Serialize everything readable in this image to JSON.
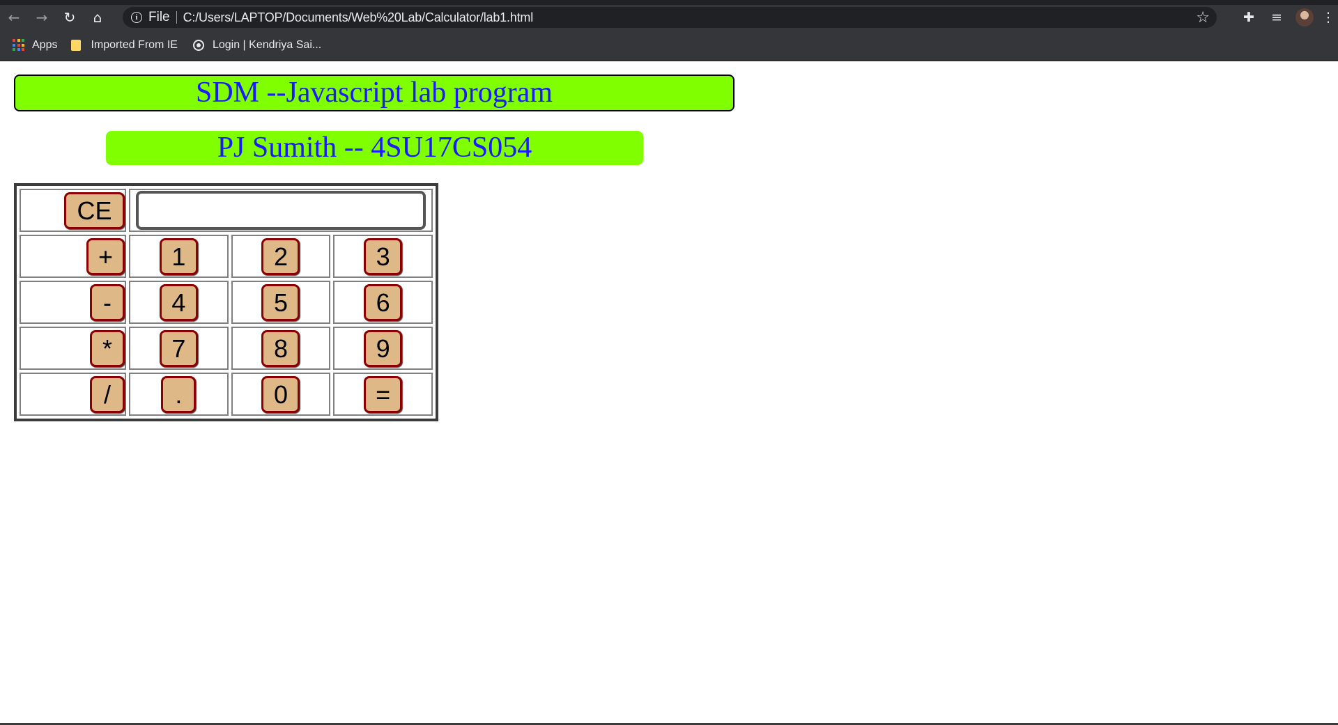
{
  "browser": {
    "nav": {
      "back_icon": "←",
      "forward_icon": "→",
      "reload_icon": "↻",
      "home_icon": "⌂"
    },
    "address": {
      "info_icon": "i",
      "scheme_label": "File",
      "url": "C:/Users/LAPTOP/Documents/Web%20Lab/Calculator/lab1.html",
      "star_icon": "☆"
    },
    "toolbar_icons": {
      "extensions_icon": "✚",
      "reading_list_icon": "≡",
      "menu_icon": "⋮"
    },
    "bookmarks": [
      {
        "label": "Apps"
      },
      {
        "label": "Imported From IE"
      },
      {
        "label": "Login | Kendriya Sai..."
      }
    ],
    "apps_colors": [
      "#ea4335",
      "#fbbc04",
      "#34a853",
      "#4285f4",
      "#ea4335",
      "#fbbc04",
      "#34a853",
      "#4285f4",
      "#ea4335"
    ]
  },
  "page": {
    "title": "SDM --Javascript lab program",
    "subtitle": "PJ Sumith -- 4SU17CS054",
    "accent_color": "#80ff00",
    "text_color": "#1a1aff"
  },
  "calculator": {
    "display_value": "",
    "clear_label": "CE",
    "rows": [
      {
        "op": "+",
        "keys": [
          "1",
          "2",
          "3"
        ]
      },
      {
        "op": "-",
        "keys": [
          "4",
          "5",
          "6"
        ]
      },
      {
        "op": "*",
        "keys": [
          "7",
          "8",
          "9"
        ]
      },
      {
        "op": "/",
        "keys": [
          ".",
          "0",
          "="
        ]
      }
    ],
    "key_color": "#deb887",
    "key_border_color": "#8b0000"
  }
}
